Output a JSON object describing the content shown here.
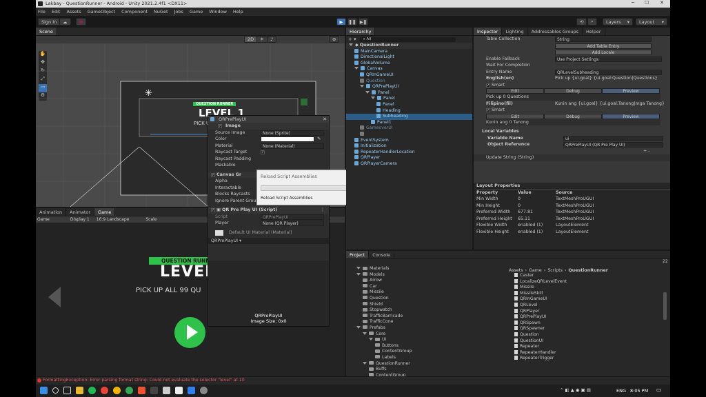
{
  "window": {
    "title": "Lakbay - QuestionRunner - Android - Unity 2021.2.4f1 <DX11>"
  },
  "menu": [
    "File",
    "Edit",
    "Assets",
    "GameObject",
    "Component",
    "NuGet",
    "Jobs",
    "Game",
    "Window",
    "Help"
  ],
  "toolbar": {
    "sign_in": "Sign In",
    "layers": "Layers",
    "layout": "Layout"
  },
  "scene": {
    "tab": "Scene",
    "mode_2d": "2D",
    "question_runner_badge": "QUESTION RUNNER",
    "level_text": "LEVEL 1",
    "pickup_text": "PICK UP AL"
  },
  "hierarchy": {
    "tab": "Hierarchy",
    "search": "All",
    "scene": "QuestionRunner",
    "items": [
      {
        "label": "MainCamera",
        "depth": 1,
        "style": "cube"
      },
      {
        "label": "DirectionalLight",
        "depth": 1,
        "style": "cube"
      },
      {
        "label": "GlobalVolume",
        "depth": 1,
        "style": "cube"
      },
      {
        "label": "Canvas",
        "depth": 1,
        "style": "cube",
        "open": true
      },
      {
        "label": "QRInGameUI",
        "depth": 2,
        "style": "cube"
      },
      {
        "label": "Question",
        "depth": 2,
        "style": "grey"
      },
      {
        "label": "QRPrePlayUI",
        "depth": 2,
        "style": "cube",
        "open": true
      },
      {
        "label": "Panel",
        "depth": 3,
        "style": "cube",
        "open": true
      },
      {
        "label": "Panel",
        "depth": 4,
        "style": "cube",
        "open": true
      },
      {
        "label": "Panel",
        "depth": 5,
        "style": "cube"
      },
      {
        "label": "Heading",
        "depth": 5,
        "style": "cube"
      },
      {
        "label": "Subheading",
        "depth": 5,
        "style": "cube",
        "selected": true
      },
      {
        "label": "Panel1",
        "depth": 4,
        "style": "cube"
      },
      {
        "label": "GameoverUI",
        "depth": 2,
        "style": "grey"
      },
      {
        "label": "",
        "depth": 2,
        "style": "grey"
      },
      {
        "label": "EventSystem",
        "depth": 1,
        "style": "cube"
      },
      {
        "label": "Initialization",
        "depth": 1,
        "style": "cube"
      },
      {
        "label": "RepeaterHandlerLocation",
        "depth": 1,
        "style": "cube"
      },
      {
        "label": "QRPlayer",
        "depth": 1,
        "style": "cube"
      },
      {
        "label": "QRPlayerCamera",
        "depth": 1,
        "style": "cube"
      }
    ]
  },
  "inspector": {
    "tabs": [
      "Inspector",
      "Lighting",
      "Addressables Groups",
      "Helper"
    ],
    "table_collection_label": "Table Collection",
    "table_collection_value": "String",
    "add_table_entry": "Add Table Entry",
    "add_locale": "Add Locale",
    "enable_fallback_label": "Enable Fallback",
    "enable_fallback_value": "Use Project Settings",
    "wait_label": "Wait For Completion",
    "entry_name_label": "Entry Name",
    "entry_name_value": "QRLevelSubheading",
    "english_label": "English(en)",
    "english_value": "Pick up {ui.goal} {ui.goal:Question|Questions}",
    "smart": "Smart",
    "edit": "Edit",
    "debug": "Debug",
    "preview": "Preview",
    "english_preview": "Pick up 0 Questions",
    "filipino_label": "Filipino(fil)",
    "filipino_value": "Kunin ang {ui.goal} {ui.goal:Tanong|mga Tanong}",
    "filipino_preview": "Kunin ang 0 Tanong",
    "local_variables": "Local Variables",
    "variable_name_label": "Variable Name",
    "variable_name_value": "ui",
    "object_reference_label": "Object Reference",
    "object_reference_value": "QRPrePlayUI (QR Pre Play UI)",
    "plus_minus": "+ -",
    "update_string": "Update String (String)",
    "layout_properties": "Layout Properties",
    "lp_headers": [
      "Property",
      "Value",
      "Source"
    ],
    "lp_rows": [
      [
        "Min Width",
        "0",
        "TextMeshProUGUI"
      ],
      [
        "Min Height",
        "0",
        "TextMeshProUGUI"
      ],
      [
        "Preferred Width",
        "677.81",
        "TextMeshProUGUI"
      ],
      [
        "Preferred Height",
        "65.11",
        "TextMeshProUGUI"
      ],
      [
        "Flexible Width",
        "enabled (1)",
        "LayoutElement"
      ],
      [
        "Flexible Height",
        "enabled (1)",
        "LayoutElement"
      ]
    ]
  },
  "float_inspector": {
    "title": "QRPrePlayUI",
    "image_header": "Image",
    "source_image_label": "Source Image",
    "source_image_value": "None (Sprite)",
    "color_label": "Color",
    "material_label": "Material",
    "material_value": "None (Material)",
    "raycast_target": "Raycast Target",
    "raycast_padding": "Raycast Padding",
    "maskable": "Maskable",
    "canvas_group": "Canvas Gr",
    "alpha": "Alpha",
    "interactable": "Interactable",
    "blocks_raycasts": "Blocks Raycasts",
    "ignore_parent": "Ignore Parent Group",
    "script_header": "QR Pre Play UI (Script)",
    "script_label": "Script",
    "script_value": "QRPrePlayUI",
    "player_label": "Player",
    "player_value": "None (QR Player)",
    "default_material": "Default UI Material (Material)",
    "dropdown": "QRPrePlayUI",
    "preview_name": "QRPrePlayUI",
    "preview_size": "Image Size: 0x0"
  },
  "dialog": {
    "title": "Reload Script Assemblies",
    "status": "Reload Script Assemblies"
  },
  "game": {
    "tabs": [
      "Animation",
      "Animator",
      "Game"
    ],
    "display": "Game",
    "display_num": "Display 1",
    "aspect": "16:9 Landscape",
    "scale": "Scale",
    "badge": "QUESTION RUNNER",
    "level": "LEVEL",
    "pickup": "PICK UP ALL 99 QU"
  },
  "project": {
    "tabs": [
      "Project",
      "Console"
    ],
    "breadcrumb": [
      "Assets",
      "Game",
      "Scripts",
      "QuestionRunner"
    ],
    "count": "22",
    "tree": [
      {
        "label": "Materials",
        "depth": 1,
        "open": true
      },
      {
        "label": "Models",
        "depth": 1,
        "open": true
      },
      {
        "label": "Arrow",
        "depth": 2
      },
      {
        "label": "Car",
        "depth": 2
      },
      {
        "label": "Missile",
        "depth": 2
      },
      {
        "label": "Question",
        "depth": 2
      },
      {
        "label": "Shield",
        "depth": 2
      },
      {
        "label": "Stopwatch",
        "depth": 2
      },
      {
        "label": "TrafficBarricade",
        "depth": 2
      },
      {
        "label": "TrafficCone",
        "depth": 2
      },
      {
        "label": "Prefabs",
        "depth": 1,
        "open": true
      },
      {
        "label": "Core",
        "depth": 2,
        "open": true
      },
      {
        "label": "UI",
        "depth": 3,
        "open": true
      },
      {
        "label": "Buttons",
        "depth": 4
      },
      {
        "label": "ContentGroup",
        "depth": 4
      },
      {
        "label": "Labels",
        "depth": 4
      },
      {
        "label": "QuestionRunner",
        "depth": 2,
        "open": true
      },
      {
        "label": "Buffs",
        "depth": 3
      },
      {
        "label": "ContentGroup",
        "depth": 3
      }
    ],
    "files": [
      "Caster",
      "LocalizeQRLevelEvent",
      "Missile",
      "MissileSkill",
      "QRInGameUI",
      "QRLevel",
      "QRPlayer",
      "QRPrePlayUI",
      "QRSpawn",
      "QRSpawner",
      "Question",
      "QuestionUI",
      "Repeater",
      "RepeaterHandler",
      "RepeaterTrigger"
    ]
  },
  "status": {
    "error": "FormattingException: Error parsing format string: Could not evaluate the selector \"level\" at 10"
  },
  "taskbar": {
    "lang": "ENG",
    "time": "8:05 PM"
  }
}
